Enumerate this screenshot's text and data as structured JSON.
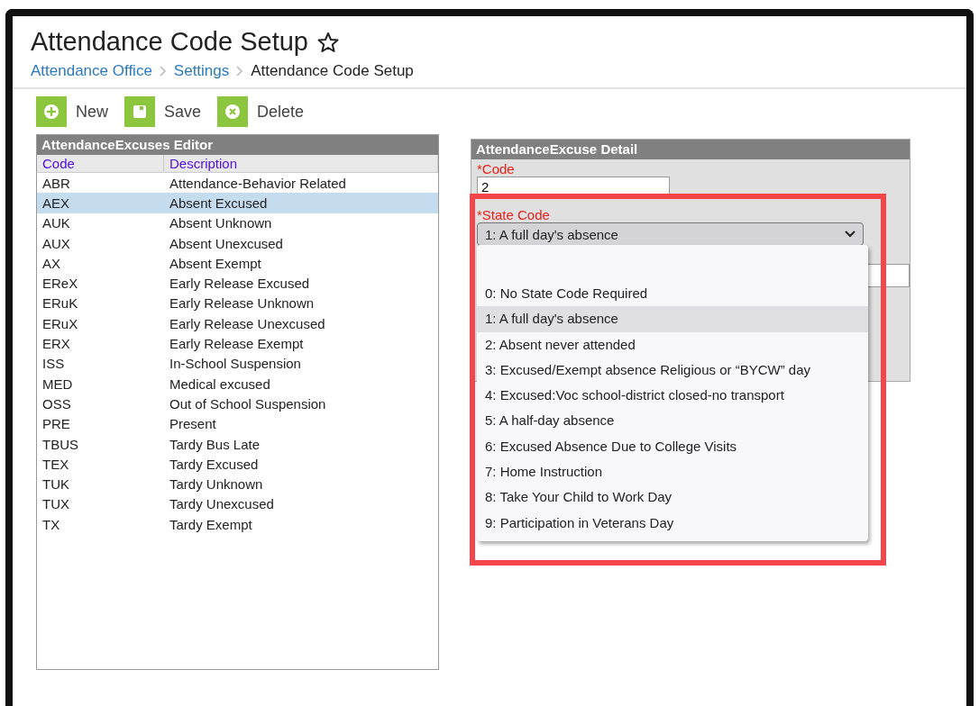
{
  "page": {
    "title": "Attendance Code Setup",
    "breadcrumb": [
      {
        "label": "Attendance Office",
        "kind": "link"
      },
      {
        "label": "Settings",
        "kind": "link"
      },
      {
        "label": "Attendance Code Setup",
        "kind": "current"
      }
    ]
  },
  "toolbar": [
    {
      "label": "New",
      "kind": "new"
    },
    {
      "label": "Save",
      "kind": "save"
    },
    {
      "label": "Delete",
      "kind": "delete"
    }
  ],
  "editor": {
    "title": "AttendanceExcuses Editor",
    "columns": [
      "Code",
      "Description"
    ],
    "rows": [
      {
        "code": "ABR",
        "description": "Attendance-Behavior Related",
        "selected": false
      },
      {
        "code": "AEX",
        "description": "Absent Excused",
        "selected": true
      },
      {
        "code": "AUK",
        "description": "Absent Unknown",
        "selected": false
      },
      {
        "code": "AUX",
        "description": "Absent Unexcused",
        "selected": false
      },
      {
        "code": "AX",
        "description": "Absent Exempt",
        "selected": false
      },
      {
        "code": "EReX",
        "description": "Early Release Excused",
        "selected": false
      },
      {
        "code": "ERuK",
        "description": "Early Release Unknown",
        "selected": false
      },
      {
        "code": "ERuX",
        "description": "Early Release Unexcused",
        "selected": false
      },
      {
        "code": "ERX",
        "description": "Early Release Exempt",
        "selected": false
      },
      {
        "code": "ISS",
        "description": "In-School Suspension",
        "selected": false
      },
      {
        "code": "MED",
        "description": "Medical excused",
        "selected": false
      },
      {
        "code": "OSS",
        "description": "Out of School Suspension",
        "selected": false
      },
      {
        "code": "PRE",
        "description": "Present",
        "selected": false
      },
      {
        "code": "TBUS",
        "description": "Tardy Bus Late",
        "selected": false
      },
      {
        "code": "TEX",
        "description": "Tardy Excused",
        "selected": false
      },
      {
        "code": "TUK",
        "description": "Tardy Unknown",
        "selected": false
      },
      {
        "code": "TUX",
        "description": "Tardy Unexcused",
        "selected": false
      },
      {
        "code": "TX",
        "description": "Tardy Exempt",
        "selected": false
      }
    ]
  },
  "detail": {
    "title": "AttendanceExcuse Detail",
    "code_label": "*Code",
    "code_value": "2",
    "state_code_label": "*State Code",
    "state_code_value": "1: A full day's absence",
    "options": [
      {
        "label": "0: No State Code Required",
        "selected": false
      },
      {
        "label": "1: A full day's absence",
        "selected": true
      },
      {
        "label": "2: Absent never attended",
        "selected": false
      },
      {
        "label": "3: Excused/Exempt absence Religious or “BYCW” day",
        "selected": false
      },
      {
        "label": "4: Excused:Voc school-district closed-no transport",
        "selected": false
      },
      {
        "label": "5: A half-day absence",
        "selected": false
      },
      {
        "label": "6: Excused Absence Due to College Visits",
        "selected": false
      },
      {
        "label": "7: Home Instruction",
        "selected": false
      },
      {
        "label": "8: Take Your Child to Work Day",
        "selected": false
      },
      {
        "label": "9: Participation in Veterans Day",
        "selected": false
      }
    ]
  }
}
